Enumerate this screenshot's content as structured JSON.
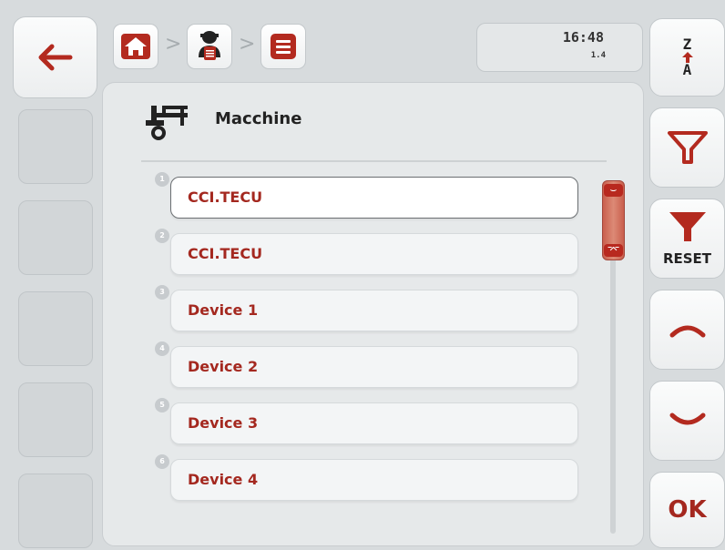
{
  "header": {
    "time": "16:48",
    "version": "1.4"
  },
  "panel": {
    "title": "Macchine"
  },
  "list": {
    "items": [
      {
        "num": "1",
        "label": "CCI.TECU",
        "selected": true
      },
      {
        "num": "2",
        "label": "CCI.TECU",
        "selected": false
      },
      {
        "num": "3",
        "label": "Device 1",
        "selected": false
      },
      {
        "num": "4",
        "label": "Device 2",
        "selected": false
      },
      {
        "num": "5",
        "label": "Device 3",
        "selected": false
      },
      {
        "num": "6",
        "label": "Device 4",
        "selected": false
      }
    ]
  },
  "right_buttons": {
    "sort_top": "Z",
    "sort_bottom": "A",
    "reset_label": "RESET",
    "ok_label": "OK"
  },
  "colors": {
    "accent": "#a4281f",
    "panel": "#e6e9ea",
    "background": "#d7dbdd"
  },
  "icons": [
    "back-arrow-icon",
    "home-icon",
    "operator-icon",
    "menu-icon",
    "machine-icon",
    "sort-za-icon",
    "filter-icon",
    "filter-reset-icon",
    "chevron-up-icon",
    "chevron-down-icon"
  ]
}
